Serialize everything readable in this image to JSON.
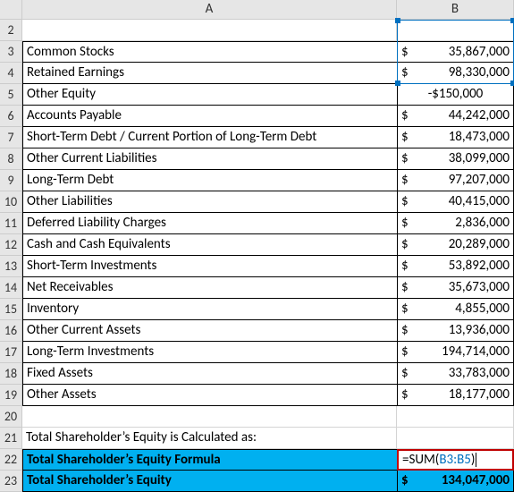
{
  "columns": {
    "A": "A",
    "B": "B"
  },
  "rows": [
    {
      "num": "2",
      "a": "",
      "sym": "",
      "val": ""
    },
    {
      "num": "3",
      "a": "Common Stocks",
      "sym": "$",
      "val": "35,867,000"
    },
    {
      "num": "4",
      "a": "Retained Earnings",
      "sym": "$",
      "val": "98,330,000"
    },
    {
      "num": "5",
      "a": "Other Equity",
      "sym": "",
      "val": "-$150,000"
    },
    {
      "num": "6",
      "a": "Accounts Payable",
      "sym": "$",
      "val": "44,242,000"
    },
    {
      "num": "7",
      "a": "Short-Term Debt / Current Portion of Long-Term Debt",
      "sym": "$",
      "val": "18,473,000"
    },
    {
      "num": "8",
      "a": "Other Current Liabilities",
      "sym": "$",
      "val": "38,099,000"
    },
    {
      "num": "9",
      "a": "Long-Term Debt",
      "sym": "$",
      "val": "97,207,000"
    },
    {
      "num": "10",
      "a": "Other Liabilities",
      "sym": "$",
      "val": "40,415,000"
    },
    {
      "num": "11",
      "a": "Deferred Liability Charges",
      "sym": "$",
      "val": "2,836,000"
    },
    {
      "num": "12",
      "a": "Cash and Cash Equivalents",
      "sym": "$",
      "val": "20,289,000"
    },
    {
      "num": "13",
      "a": "Short-Term Investments",
      "sym": "$",
      "val": "53,892,000"
    },
    {
      "num": "14",
      "a": "Net Receivables",
      "sym": "$",
      "val": "35,673,000"
    },
    {
      "num": "15",
      "a": "Inventory",
      "sym": "$",
      "val": "4,855,000"
    },
    {
      "num": "16",
      "a": "Other Current Assets",
      "sym": "$",
      "val": "13,936,000"
    },
    {
      "num": "17",
      "a": "Long-Term Investments",
      "sym": "$",
      "val": "194,714,000"
    },
    {
      "num": "18",
      "a": "Fixed Assets",
      "sym": "$",
      "val": "33,783,000"
    },
    {
      "num": "19",
      "a": "Other Assets",
      "sym": "$",
      "val": "18,177,000"
    },
    {
      "num": "20",
      "a": "",
      "sym": "",
      "val": ""
    }
  ],
  "footer": {
    "heading_row": "21",
    "heading": "Total Shareholder’s Equity is Calculated as:",
    "formula_row": "22",
    "formula_label": "Total Shareholder’s Equity Formula",
    "formula_prefix": "=SUM(",
    "formula_ref": "B3:B5",
    "formula_suffix": ")",
    "result_row": "23",
    "result_label": "Total Shareholder’s Equity",
    "result_sym": "$",
    "result_val": "134,047,000"
  }
}
